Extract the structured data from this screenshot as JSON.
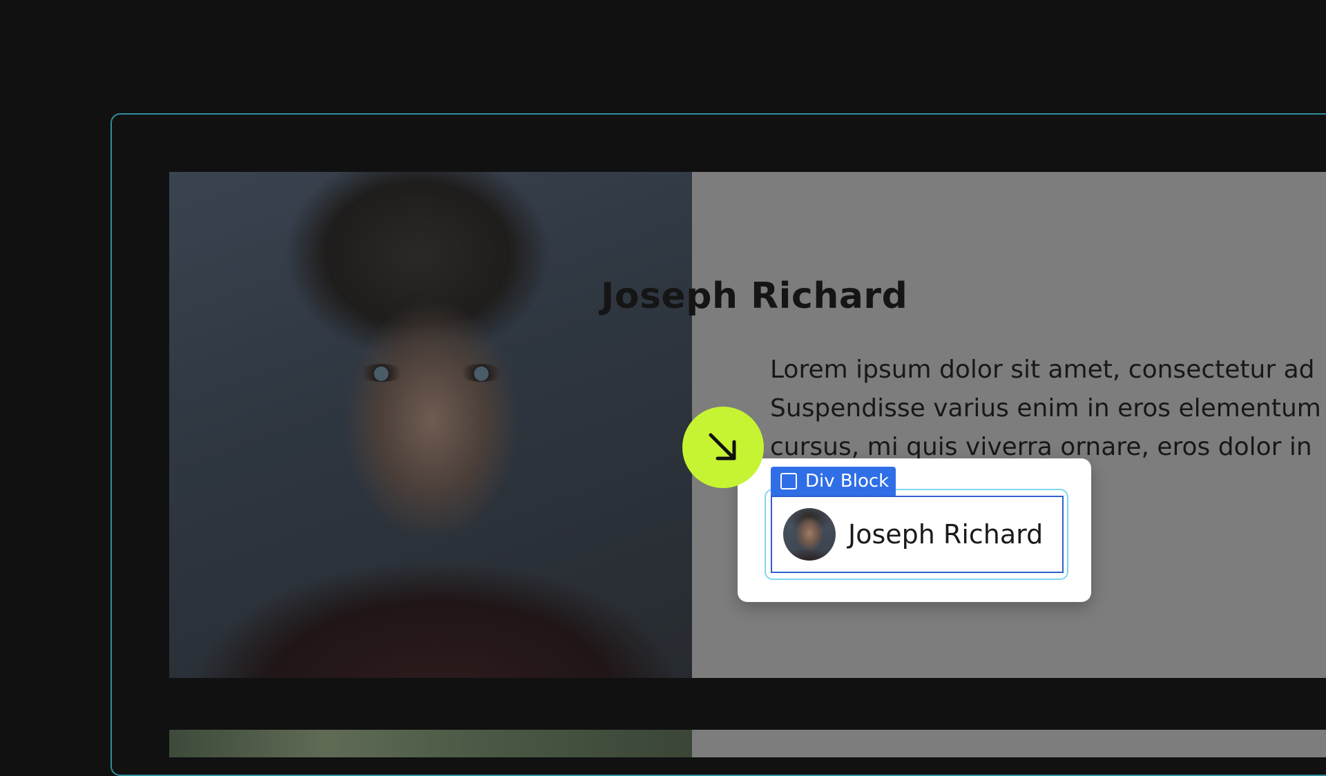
{
  "profile": {
    "name": "Joseph Richard",
    "bio_lines": [
      "Lorem ipsum dolor sit amet, consectetur ad",
      "Suspendisse varius enim in eros elementum",
      "cursus, mi quis viverra ornare, eros dolor in"
    ]
  },
  "selection": {
    "tag_label": "Div Block",
    "element_name": "Joseph Richard"
  },
  "colors": {
    "accent_cursor": "#c6f432",
    "selection_blue": "#2f6ee6",
    "frame_teal": "#2f8f9d"
  },
  "icons": {
    "cursor": "arrow-down-right-icon",
    "tag": "square-icon"
  }
}
